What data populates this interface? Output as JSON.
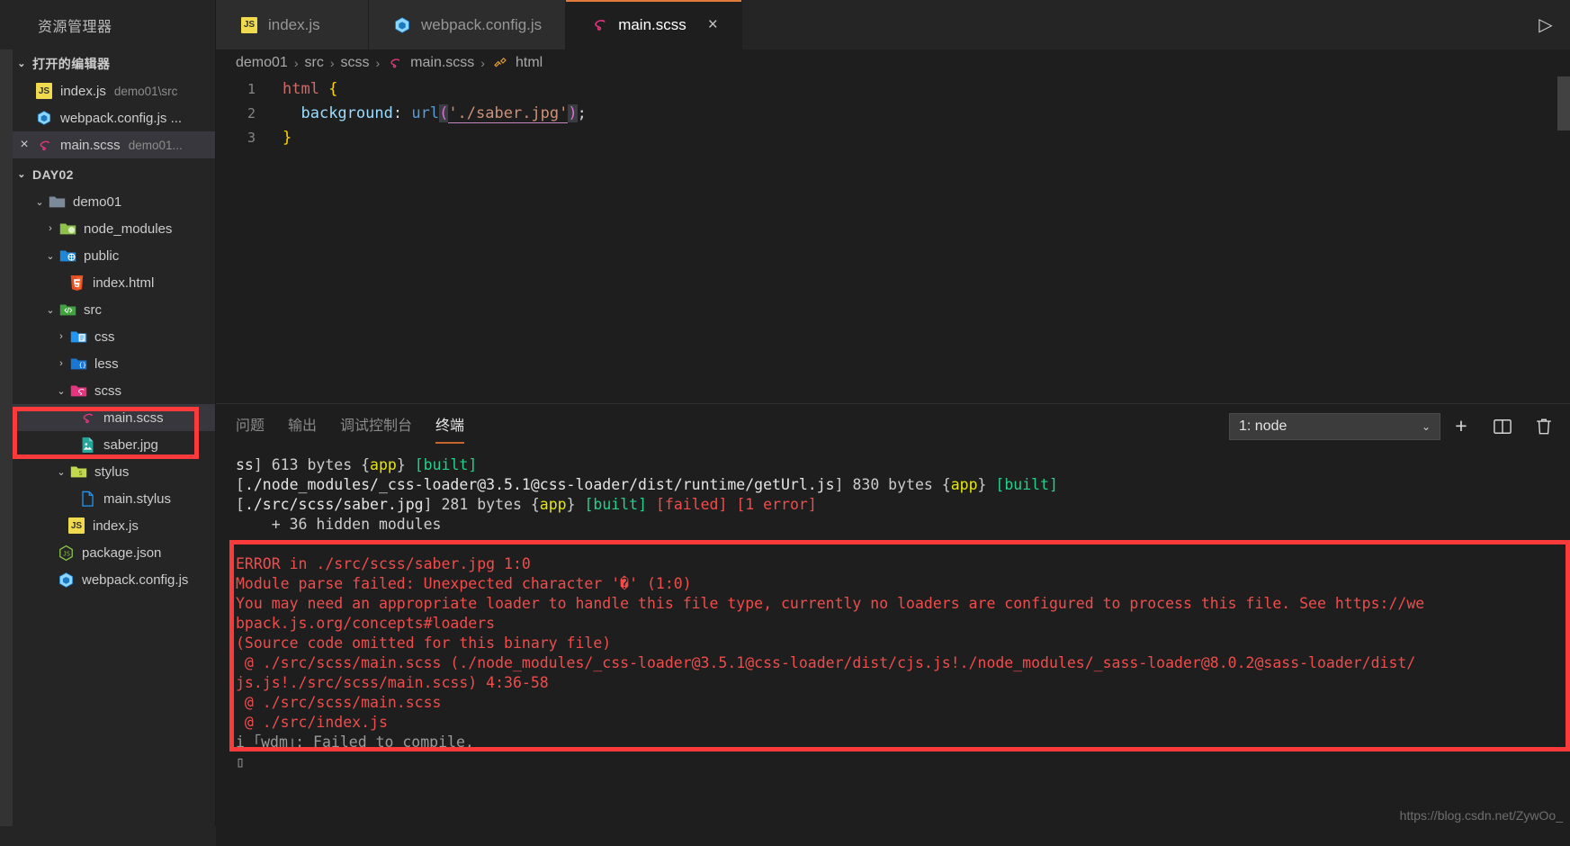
{
  "window": {
    "explorer_title": "资源管理器",
    "run_icon": "run-play-icon"
  },
  "tabs": [
    {
      "label": "index.js",
      "icon": "js-file-icon",
      "active": false
    },
    {
      "label": "webpack.config.js",
      "icon": "webpack-file-icon",
      "active": false
    },
    {
      "label": "main.scss",
      "icon": "sass-file-icon",
      "active": true,
      "close": "×"
    }
  ],
  "sidebar": {
    "open_editors": {
      "title": "打开的编辑器",
      "items": [
        {
          "name": "index.js",
          "path": "demo01\\src",
          "icon": "js-file-icon",
          "dirty": false
        },
        {
          "name": "webpack.config.js ...",
          "path": "",
          "icon": "webpack-file-icon",
          "dirty": false
        },
        {
          "name": "main.scss",
          "path": "demo01...",
          "icon": "sass-file-icon",
          "close": "×",
          "selected": true
        }
      ]
    },
    "workspace": {
      "title": "DAY02",
      "tree": [
        {
          "label": "demo01",
          "icon": "folder-icon",
          "depth": 1,
          "state": "expanded"
        },
        {
          "label": "node_modules",
          "icon": "folder-node-icon",
          "depth": 2,
          "state": "collapsed"
        },
        {
          "label": "public",
          "icon": "folder-public-icon",
          "depth": 2,
          "state": "expanded"
        },
        {
          "label": "index.html",
          "icon": "html-file-icon",
          "depth": 3,
          "state": "file"
        },
        {
          "label": "src",
          "icon": "folder-src-icon",
          "depth": 2,
          "state": "expanded"
        },
        {
          "label": "css",
          "icon": "folder-css-icon",
          "depth": 3,
          "state": "collapsed"
        },
        {
          "label": "less",
          "icon": "folder-less-icon",
          "depth": 3,
          "state": "collapsed"
        },
        {
          "label": "scss",
          "icon": "folder-sass-icon",
          "depth": 3,
          "state": "expanded"
        },
        {
          "label": "main.scss",
          "icon": "sass-file-icon",
          "depth": 4,
          "state": "file",
          "selected": true
        },
        {
          "label": "saber.jpg",
          "icon": "image-file-icon",
          "depth": 4,
          "state": "file"
        },
        {
          "label": "stylus",
          "icon": "folder-stylus-icon",
          "depth": 3,
          "state": "expanded"
        },
        {
          "label": "main.stylus",
          "icon": "plain-file-icon",
          "depth": 4,
          "state": "file"
        },
        {
          "label": "index.js",
          "icon": "js-file-icon",
          "depth": 3,
          "state": "file"
        },
        {
          "label": "package.json",
          "icon": "npm-file-icon",
          "depth": 2,
          "state": "file"
        },
        {
          "label": "webpack.config.js",
          "icon": "webpack-file-icon",
          "depth": 2,
          "state": "file"
        }
      ]
    }
  },
  "breadcrumb": {
    "items": [
      {
        "label": "demo01",
        "icon": null
      },
      {
        "label": "src",
        "icon": null
      },
      {
        "label": "scss",
        "icon": null
      },
      {
        "label": "main.scss",
        "icon": "sass-file-icon"
      },
      {
        "label": "html",
        "icon": "css-selector-icon"
      }
    ],
    "separator": "›"
  },
  "editor": {
    "lines": [
      {
        "num": "1",
        "text": "html {"
      },
      {
        "num": "2",
        "text": "  background: url('./saber.jpg');"
      },
      {
        "num": "3",
        "text": "}"
      }
    ],
    "line1": {
      "tag": "html",
      "brace": "{"
    },
    "line2": {
      "indent": "  ",
      "prop": "background",
      "colon": ":",
      "fn": "url",
      "open_paren": "(",
      "string": "'./saber.jpg'",
      "close_paren": ")",
      "semi": ";"
    },
    "line3": {
      "brace": "}"
    }
  },
  "panel": {
    "tabs": [
      {
        "label": "问题",
        "active": false
      },
      {
        "label": "输出",
        "active": false
      },
      {
        "label": "调试控制台",
        "active": false
      },
      {
        "label": "终端",
        "active": true
      }
    ],
    "terminal_select": {
      "value": "1: node",
      "caret": "⌄"
    },
    "actions": [
      {
        "name": "new-terminal-button",
        "glyph": "+"
      },
      {
        "name": "split-terminal-button",
        "glyph": "▯▯"
      },
      {
        "name": "kill-terminal-button",
        "glyph": "🗑"
      }
    ]
  },
  "terminal": {
    "lines": [
      {
        "id": "l1",
        "segments": [
          {
            "t": "ss",
            "c": "white"
          },
          {
            "t": "] 613 bytes ",
            "c": "gray"
          },
          {
            "t": "{",
            "c": "gray"
          },
          {
            "t": "app",
            "c": "yellow"
          },
          {
            "t": "} ",
            "c": "gray"
          },
          {
            "t": "[built]",
            "c": "green"
          }
        ]
      },
      {
        "id": "l2",
        "segments": [
          {
            "t": "[",
            "c": "gray"
          },
          {
            "t": "./node_modules/_css-loader@3.5.1@css-loader/dist/runtime/getUrl.js",
            "c": "white"
          },
          {
            "t": "] 830 bytes ",
            "c": "gray"
          },
          {
            "t": "{",
            "c": "gray"
          },
          {
            "t": "app",
            "c": "yellow"
          },
          {
            "t": "} ",
            "c": "gray"
          },
          {
            "t": "[built]",
            "c": "green"
          }
        ]
      },
      {
        "id": "l3",
        "segments": [
          {
            "t": "[",
            "c": "gray"
          },
          {
            "t": "./src/scss/saber.jpg",
            "c": "white"
          },
          {
            "t": "] 281 bytes ",
            "c": "gray"
          },
          {
            "t": "{",
            "c": "gray"
          },
          {
            "t": "app",
            "c": "yellow"
          },
          {
            "t": "} ",
            "c": "gray"
          },
          {
            "t": "[built]",
            "c": "green"
          },
          {
            "t": " ",
            "c": "gray"
          },
          {
            "t": "[failed]",
            "c": "red"
          },
          {
            "t": " ",
            "c": "gray"
          },
          {
            "t": "[1 error]",
            "c": "red"
          }
        ]
      },
      {
        "id": "l4",
        "segments": [
          {
            "t": "    + 36 hidden modules",
            "c": "gray"
          }
        ]
      },
      {
        "id": "l5",
        "segments": [
          {
            "t": "",
            "c": "gray"
          }
        ]
      },
      {
        "id": "l6",
        "segments": [
          {
            "t": "ERROR in ./src/scss/saber.jpg 1:0",
            "c": "err"
          }
        ]
      },
      {
        "id": "l7",
        "segments": [
          {
            "t": "Module parse failed: Unexpected character '�' (1:0)",
            "c": "err"
          }
        ]
      },
      {
        "id": "l8",
        "segments": [
          {
            "t": "You may need an appropriate loader to handle this file type, currently no loaders are configured to process this file. See https://we",
            "c": "err"
          }
        ]
      },
      {
        "id": "l9",
        "segments": [
          {
            "t": "bpack.js.org/concepts#loaders",
            "c": "err"
          }
        ]
      },
      {
        "id": "l10",
        "segments": [
          {
            "t": "(Source code omitted for this binary file)",
            "c": "err"
          }
        ]
      },
      {
        "id": "l11",
        "segments": [
          {
            "t": " @ ./src/scss/main.scss (./node_modules/_css-loader@3.5.1@css-loader/dist/cjs.js!./node_modules/_sass-loader@8.0.2@sass-loader/dist/",
            "c": "err"
          }
        ]
      },
      {
        "id": "l12",
        "segments": [
          {
            "t": "js.js!./src/scss/main.scss) 4:36-58",
            "c": "err"
          }
        ]
      },
      {
        "id": "l13",
        "segments": [
          {
            "t": " @ ./src/scss/main.scss",
            "c": "err"
          }
        ]
      },
      {
        "id": "l14",
        "segments": [
          {
            "t": " @ ./src/index.js",
            "c": "err"
          }
        ]
      },
      {
        "id": "l15",
        "segments": [
          {
            "t": "i ｢wdm｣: Failed to compile.",
            "c": "dim"
          }
        ]
      }
    ]
  },
  "annotations": {
    "sidebar_box_color": "#fb3b3b",
    "terminal_box_color": "#fb3b3b"
  },
  "watermark": {
    "text": "https://blog.csdn.net/ZywOo_"
  }
}
